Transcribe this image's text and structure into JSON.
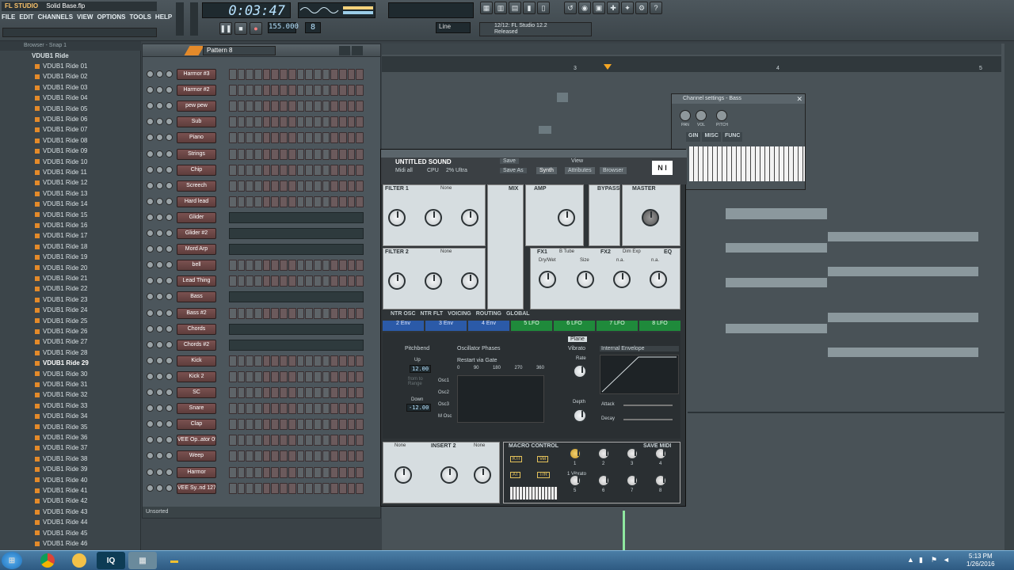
{
  "window": {
    "title": "Solid Base.flp",
    "app_logo": "FL STUDIO"
  },
  "menu": [
    "FILE",
    "EDIT",
    "CHANNELS",
    "VIEW",
    "OPTIONS",
    "TOOLS",
    "HELP"
  ],
  "transport": {
    "time": "0:03:47",
    "tempo": "155.000",
    "pattern_num": "8",
    "hint_line1": "12/12: FL Studio 12.2",
    "hint_line2": "Released",
    "snap": "Line"
  },
  "browser": {
    "title": "Browser - Snap 1",
    "root": "VDUB1 Ride",
    "items": [
      "VDUB1 Ride 01",
      "VDUB1 Ride 02",
      "VDUB1 Ride 03",
      "VDUB1 Ride 04",
      "VDUB1 Ride 05",
      "VDUB1 Ride 06",
      "VDUB1 Ride 07",
      "VDUB1 Ride 08",
      "VDUB1 Ride 09",
      "VDUB1 Ride 10",
      "VDUB1 Ride 11",
      "VDUB1 Ride 12",
      "VDUB1 Ride 13",
      "VDUB1 Ride 14",
      "VDUB1 Ride 15",
      "VDUB1 Ride 16",
      "VDUB1 Ride 17",
      "VDUB1 Ride 18",
      "VDUB1 Ride 19",
      "VDUB1 Ride 20",
      "VDUB1 Ride 21",
      "VDUB1 Ride 22",
      "VDUB1 Ride 23",
      "VDUB1 Ride 24",
      "VDUB1 Ride 25",
      "VDUB1 Ride 26",
      "VDUB1 Ride 27",
      "VDUB1 Ride 28",
      "VDUB1 Ride 29",
      "VDUB1 Ride 30",
      "VDUB1 Ride 31",
      "VDUB1 Ride 32",
      "VDUB1 Ride 33",
      "VDUB1 Ride 34",
      "VDUB1 Ride 35",
      "VDUB1 Ride 36",
      "VDUB1 Ride 37",
      "VDUB1 Ride 38",
      "VDUB1 Ride 39",
      "VDUB1 Ride 40",
      "VDUB1 Ride 41",
      "VDUB1 Ride 42",
      "VDUB1 Ride 43",
      "VDUB1 Ride 44",
      "VDUB1 Ride 45",
      "VDUB1 Ride 46"
    ],
    "selected_index": 28
  },
  "rack": {
    "title": "Pattern 8",
    "footer": "Unsorted",
    "channels": [
      "Harmor #3",
      "Harmor #2",
      "pew pew",
      "Sub",
      "Piano",
      "Strings",
      "Chip",
      "Screech",
      "Hard lead",
      "Glider",
      "Glider #2",
      "Mord Arp",
      "bell",
      "Lead Thing",
      "Bass",
      "Bass #2",
      "Chords",
      "Chords #2",
      "Kick",
      "Kick 2",
      "SC",
      "Snare",
      "Clap",
      "VEE Op..ator 05",
      "Weep",
      "Harmor",
      "VEE Sy..nd 127"
    ],
    "piano_roll_rows": [
      9,
      10,
      11,
      14,
      16,
      17
    ]
  },
  "playlist": {
    "bar_numbers": [
      "3",
      "4",
      "5"
    ]
  },
  "massive": {
    "preset": "UNTITLED SOUND",
    "midi": "Midi all",
    "cpu": "CPU",
    "quality": "2% Ultra",
    "save": "Save",
    "save_as": "Save As",
    "view": "View",
    "views": [
      "Synth",
      "Attributes",
      "Browser"
    ],
    "filter1": "FILTER 1",
    "filter2": "FILTER 2",
    "filter_none": "None",
    "mix": "MIX",
    "amp": "AMP",
    "bypass": "BYPASS",
    "master": "MASTER",
    "fx1": "FX1",
    "fx1_type": "B Tube",
    "fx2": "FX2",
    "fx2_type": "Dim Exp",
    "eq": "EQ",
    "fx_knobs": [
      "Dry/Wet",
      "Size",
      "n.a.",
      "n.a."
    ],
    "tabs": [
      "NTR OSC",
      "NTR FLT",
      "VOICING",
      "ROUTING",
      "GLOBAL"
    ],
    "mod_slots": [
      "2 Env",
      "3 Env",
      "4 Env",
      "5 LFO",
      "6 LFO",
      "7 LFO",
      "8 LFO"
    ],
    "pitchbend": "Pitchbend",
    "up": "Up",
    "up_val": "12.00",
    "down": "Down",
    "down_val": "-12.00",
    "range": "from to Range",
    "osc_phases": "Oscillator Phases",
    "restart": "Restart via Gate",
    "phase_vals": [
      "0",
      "90",
      "180",
      "270",
      "360"
    ],
    "oscs": [
      "Osc1",
      "Osc2",
      "Osc3",
      "M Osc"
    ],
    "plane": "Plane",
    "vibrato": "Vibrato",
    "internal_env": "Internal Envelope",
    "rate": "Rate",
    "depth": "Depth",
    "attack": "Attack",
    "decay": "Decay",
    "insert2": "INSERT 2",
    "macro": "MACRO CONTROL",
    "save_midi": "SAVE MIDI",
    "macro_label": "1 Vibrato",
    "macro_nums": [
      "1",
      "2",
      "3",
      "4",
      "5",
      "6",
      "7",
      "8"
    ],
    "macro_tags": [
      "KTr",
      "Vel",
      "AT",
      "TrR"
    ]
  },
  "chset": {
    "title": "Channel settings - Bass",
    "tabs": [
      "GIN",
      "MISC",
      "FUNC"
    ],
    "knobs": [
      "PAN",
      "VOL",
      "PITCH"
    ]
  },
  "taskbar": {
    "time": "5:13 PM",
    "date": "1/26/2016"
  }
}
